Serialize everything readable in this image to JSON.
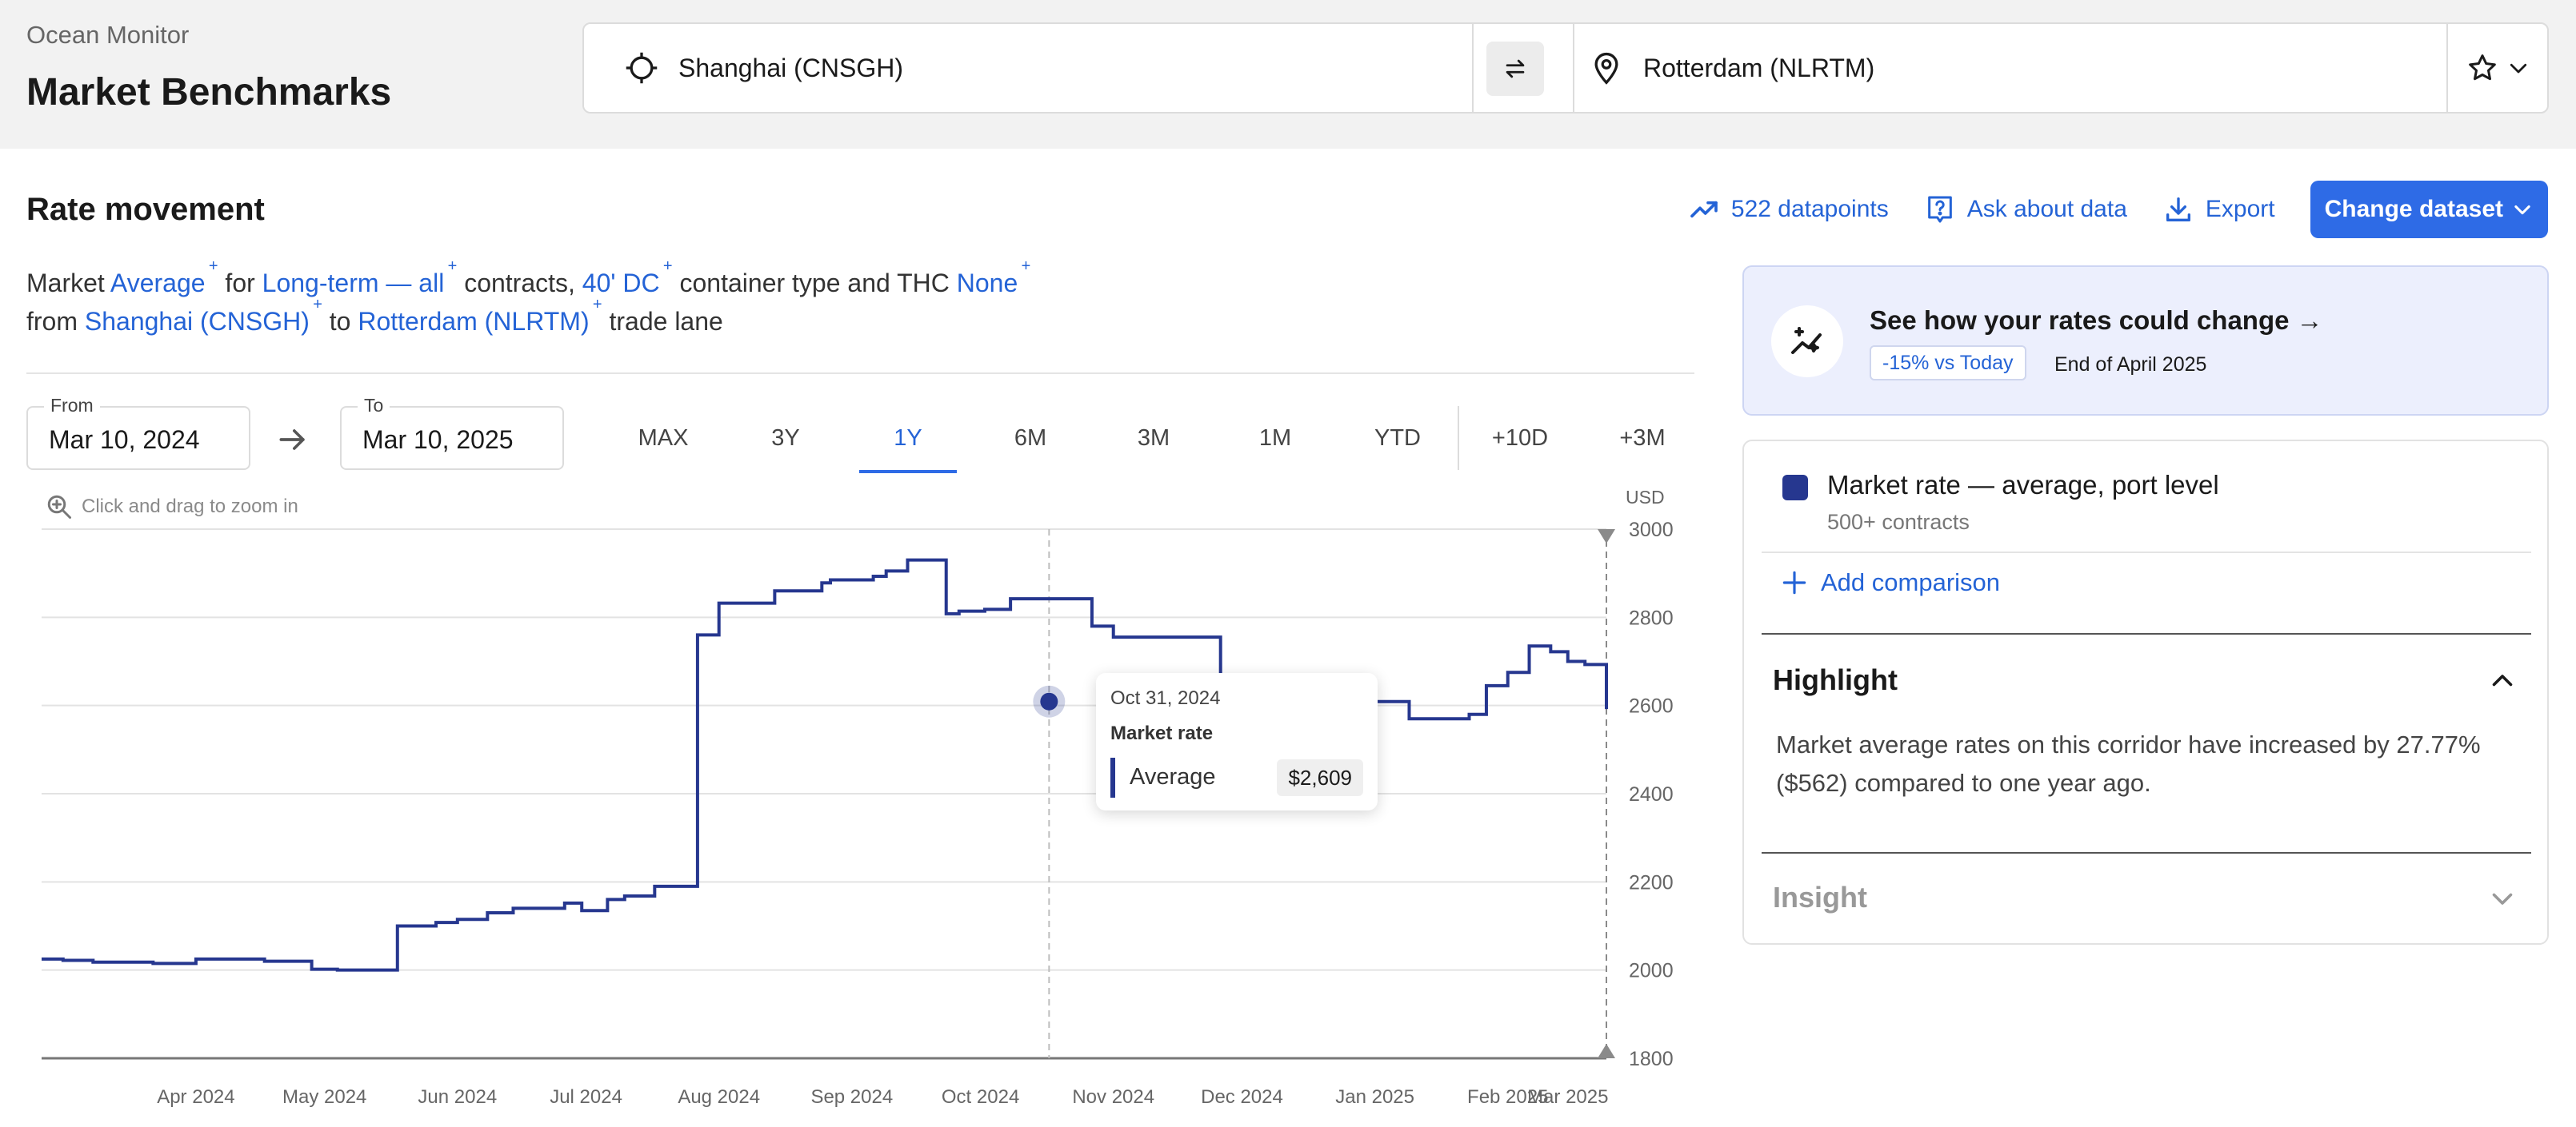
{
  "header": {
    "app_name": "Ocean Monitor",
    "page_title": "Market Benchmarks",
    "origin": "Shanghai (CNSGH)",
    "destination": "Rotterdam (NLRTM)"
  },
  "section": {
    "title": "Rate movement",
    "datapoints": "522 datapoints",
    "ask": "Ask about data",
    "export": "Export",
    "change_dataset": "Change dataset"
  },
  "description": {
    "w_market": "Market",
    "market": "Average",
    "w_for": "for",
    "contract": "Long-term — all",
    "w_contracts": "contracts,",
    "container": "40' DC",
    "w_container": "container type and THC",
    "thc": "None",
    "w_from": "from",
    "origin": "Shanghai (CNSGH)",
    "w_to": "to",
    "destination": "Rotterdam (NLRTM)",
    "w_lane": "trade lane",
    "plus": "+"
  },
  "dates": {
    "from_label": "From",
    "from_value": "Mar 10, 2024",
    "to_label": "To",
    "to_value": "Mar 10, 2025"
  },
  "ranges": [
    "MAX",
    "3Y",
    "1Y",
    "6M",
    "3M",
    "1M",
    "YTD",
    "+10D",
    "+3M"
  ],
  "active_range": "1Y",
  "chart_hint": "Click and drag to zoom in",
  "chart_data": {
    "type": "line",
    "ylabel": "USD",
    "ylim": [
      1800,
      3000
    ],
    "y_ticks": [
      3000,
      2800,
      2600,
      2400,
      2200,
      2000,
      1800
    ],
    "x_ticks": [
      "Apr 2024",
      "May 2024",
      "Jun 2024",
      "Jul 2024",
      "Aug 2024",
      "Sep 2024",
      "Oct 2024",
      "Nov 2024",
      "Dec 2024",
      "Jan 2025",
      "Feb 2025",
      "Mar 2025"
    ],
    "step": true,
    "grid": true,
    "series": [
      {
        "name": "Market rate — average, port level",
        "color": "#26378f",
        "x": [
          "2024-03-10",
          "2024-03-15",
          "2024-03-22",
          "2024-04-05",
          "2024-04-15",
          "2024-05-01",
          "2024-05-12",
          "2024-05-18",
          "2024-05-25",
          "2024-06-01",
          "2024-06-10",
          "2024-06-15",
          "2024-06-22",
          "2024-06-28",
          "2024-07-10",
          "2024-07-14",
          "2024-07-20",
          "2024-07-24",
          "2024-07-31",
          "2024-08-10",
          "2024-08-15",
          "2024-08-28",
          "2024-09-08",
          "2024-09-10",
          "2024-09-20",
          "2024-09-23",
          "2024-09-28",
          "2024-10-07",
          "2024-10-10",
          "2024-10-16",
          "2024-10-22",
          "2024-11-10",
          "2024-11-15",
          "2024-12-10",
          "2024-12-15",
          "2025-01-01",
          "2025-01-05",
          "2025-01-15",
          "2025-01-23",
          "2025-02-06",
          "2025-02-10",
          "2025-02-15",
          "2025-02-20",
          "2025-02-25",
          "2025-03-01",
          "2025-03-05",
          "2025-03-10"
        ],
        "y": [
          2025,
          2022,
          2018,
          2015,
          2025,
          2020,
          2002,
          2000,
          2000,
          2100,
          2108,
          2115,
          2130,
          2140,
          2152,
          2135,
          2160,
          2168,
          2190,
          2760,
          2832,
          2860,
          2878,
          2885,
          2893,
          2905,
          2930,
          2808,
          2814,
          2818,
          2842,
          2780,
          2755,
          2605,
          2575,
          2565,
          2568,
          2609,
          2570,
          2580,
          2645,
          2675,
          2735,
          2722,
          2700,
          2693,
          2592
        ],
        "_note": "values read from plot"
      }
    ],
    "crosshair_date": "2024-10-31"
  },
  "tooltip": {
    "date": "Oct 31, 2024",
    "label": "Market rate",
    "series": "Average",
    "value": "$2,609"
  },
  "promo": {
    "title": "See how your rates could change →",
    "badge": "-15% vs Today",
    "date": "End of April 2025"
  },
  "panel": {
    "legend_name": "Market rate — average, port level",
    "legend_sub": "500+ contracts",
    "add_comparison": "Add comparison",
    "highlight_title": "Highlight",
    "highlight_text": "Market average rates on this corridor have increased by 27.77% ($562) compared to one year ago.",
    "insight_title": "Insight"
  }
}
